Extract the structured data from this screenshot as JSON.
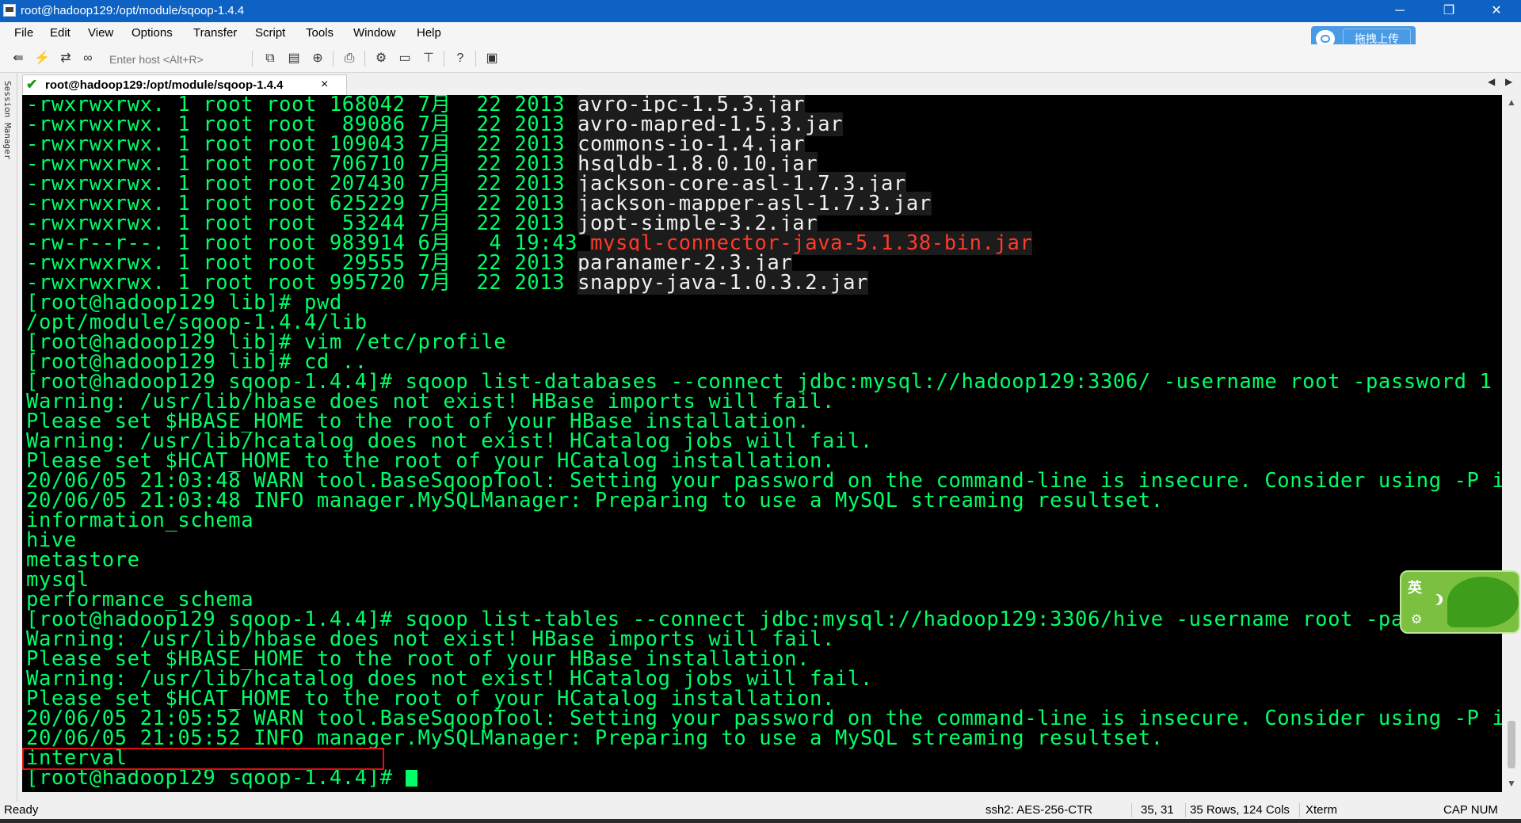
{
  "window": {
    "title": "root@hadoop129:/opt/module/sqoop-1.4.4",
    "minimize_glyph": "─",
    "restore_glyph": "❐",
    "close_glyph": "✕"
  },
  "menu": [
    "File",
    "Edit",
    "View",
    "Options",
    "Transfer",
    "Script",
    "Tools",
    "Window",
    "Help"
  ],
  "upload_button": {
    "label": "拖拽上传"
  },
  "toolbar": {
    "host_placeholder": "Enter host <Alt+R>",
    "icons": [
      "connect-bar-icon",
      "lightning-icon",
      "reconnect-icon",
      "link-icon",
      "copy-icon",
      "paste-icon",
      "find-icon",
      "print-icon",
      "settings-icon",
      "keymap-icon",
      "sftp-icon",
      "help-icon",
      "screen-icon"
    ]
  },
  "tab": {
    "label": "root@hadoop129:/opt/module/sqoop-1.4.4",
    "close_glyph": "×"
  },
  "session_panel": {
    "label": "Session Manager"
  },
  "terminal": {
    "colors": {
      "foreground": "#00ff66",
      "background": "#000000",
      "highlight_red": "#ff3a2a"
    },
    "lines": [
      {
        "text": "-rwxrwxrwx. 1 root root 168042 7月  22 2013 ",
        "file": "avro-ipc-1.5.3.jar"
      },
      {
        "text": "-rwxrwxrwx. 1 root root  89086 7月  22 2013 ",
        "file": "avro-mapred-1.5.3.jar"
      },
      {
        "text": "-rwxrwxrwx. 1 root root 109043 7月  22 2013 ",
        "file": "commons-io-1.4.jar"
      },
      {
        "text": "-rwxrwxrwx. 1 root root 706710 7月  22 2013 ",
        "file": "hsqldb-1.8.0.10.jar"
      },
      {
        "text": "-rwxrwxrwx. 1 root root 207430 7月  22 2013 ",
        "file": "jackson-core-asl-1.7.3.jar"
      },
      {
        "text": "-rwxrwxrwx. 1 root root 625229 7月  22 2013 ",
        "file": "jackson-mapper-asl-1.7.3.jar"
      },
      {
        "text": "-rwxrwxrwx. 1 root root  53244 7月  22 2013 ",
        "file": "jopt-simple-3.2.jar"
      },
      {
        "text": "-rw-r--r--. 1 root root 983914 6月   4 19:43 ",
        "file_red": "mysql-connector-java-5.1.38-bin.jar"
      },
      {
        "text": "-rwxrwxrwx. 1 root root  29555 7月  22 2013 ",
        "file": "paranamer-2.3.jar"
      },
      {
        "text": "-rwxrwxrwx. 1 root root 995720 7月  22 2013 ",
        "file": "snappy-java-1.0.3.2.jar"
      },
      {
        "text": "[root@hadoop129 lib]# pwd"
      },
      {
        "text": "/opt/module/sqoop-1.4.4/lib"
      },
      {
        "text": "[root@hadoop129 lib]# vim /etc/profile"
      },
      {
        "text": "[root@hadoop129 lib]# cd .."
      },
      {
        "text": "[root@hadoop129 sqoop-1.4.4]# sqoop list-databases --connect jdbc:mysql://hadoop129:3306/ -username root -password 1"
      },
      {
        "text": "Warning: /usr/lib/hbase does not exist! HBase imports will fail."
      },
      {
        "text": "Please set $HBASE_HOME to the root of your HBase installation."
      },
      {
        "text": "Warning: /usr/lib/hcatalog does not exist! HCatalog jobs will fail."
      },
      {
        "text": "Please set $HCAT_HOME to the root of your HCatalog installation."
      },
      {
        "text": "20/06/05 21:03:48 WARN tool.BaseSqoopTool: Setting your password on the command-line is insecure. Consider using -P instead."
      },
      {
        "text": "20/06/05 21:03:48 INFO manager.MySQLManager: Preparing to use a MySQL streaming resultset."
      },
      {
        "text": "information_schema"
      },
      {
        "text": "hive"
      },
      {
        "text": "metastore"
      },
      {
        "text": "mysql"
      },
      {
        "text": "performance_schema"
      },
      {
        "text": "[root@hadoop129 sqoop-1.4.4]# sqoop list-tables --connect jdbc:mysql://hadoop129:3306/hive -username root -password"
      },
      {
        "text": "Warning: /usr/lib/hbase does not exist! HBase imports will fail."
      },
      {
        "text": "Please set $HBASE_HOME to the root of your HBase installation."
      },
      {
        "text": "Warning: /usr/lib/hcatalog does not exist! HCatalog jobs will fail."
      },
      {
        "text": "Please set $HCAT_HOME to the root of your HCatalog installation."
      },
      {
        "text": "20/06/05 21:05:52 WARN tool.BaseSqoopTool: Setting your password on the command-line is insecure. Consider using -P instead."
      },
      {
        "text": "20/06/05 21:05:52 INFO manager.MySQLManager: Preparing to use a MySQL streaming resultset."
      },
      {
        "text": "interval"
      },
      {
        "text": "[root@hadoop129 sqoop-1.4.4]# ",
        "cursor": true
      }
    ]
  },
  "ime": {
    "label": "英"
  },
  "status": {
    "ready": "Ready",
    "cipher": "ssh2: AES-256-CTR",
    "position": "35,  31",
    "size": "35 Rows, 124 Cols",
    "term": "Xterm",
    "keys": "CAP NUM"
  }
}
